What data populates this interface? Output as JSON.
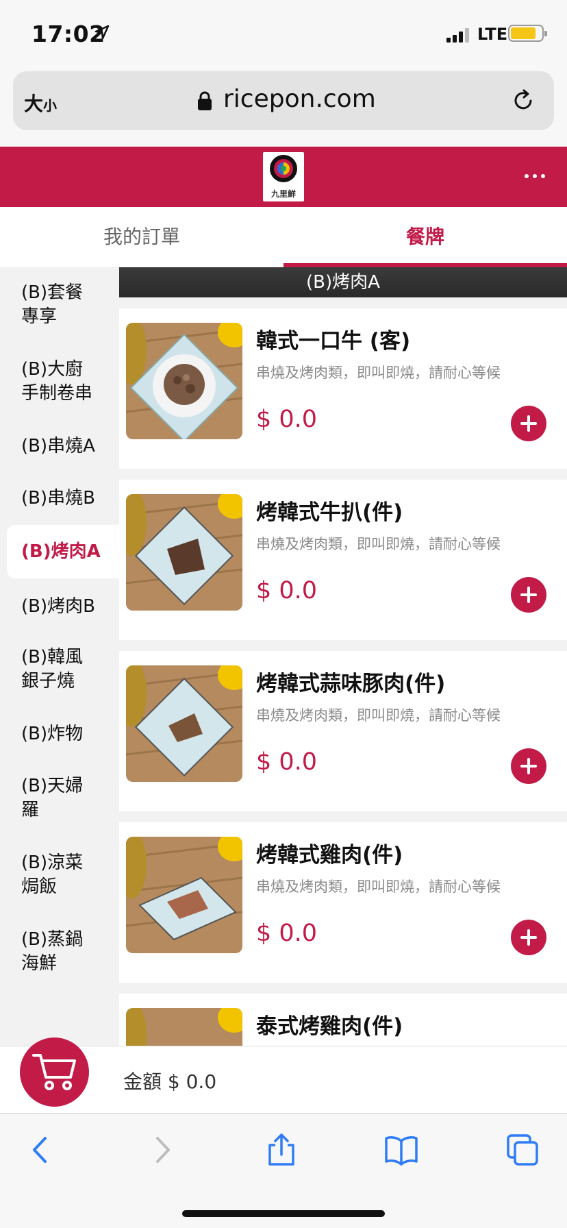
{
  "status_bar": {
    "time": "17:02",
    "network": "LTE",
    "battery_color": "#f5c518"
  },
  "browser": {
    "text_size_label": "大",
    "text_size_small": "小",
    "url": "ricepon.com"
  },
  "header": {
    "logo_text": "九里鮮",
    "brand_color": "#c21b48"
  },
  "tabs": [
    {
      "label": "我的訂單",
      "active": false
    },
    {
      "label": "餐牌",
      "active": true
    }
  ],
  "sidebar": {
    "categories": [
      {
        "label": "(B)套餐\n專享"
      },
      {
        "label": "(B)大廚\n手制卷串"
      },
      {
        "label": "(B)串燒A"
      },
      {
        "label": "(B)串燒B"
      },
      {
        "label": "(B)烤肉A",
        "active": true
      },
      {
        "label": "(B)烤肉B"
      },
      {
        "label": "(B)韓風\n銀子燒"
      },
      {
        "label": "(B)炸物"
      },
      {
        "label": "(B)天婦\n羅"
      },
      {
        "label": "(B)涼菜\n焗飯"
      },
      {
        "label": "(B)蒸鍋\n海鮮"
      }
    ]
  },
  "section": {
    "title": "(B)烤肉A"
  },
  "items": [
    {
      "name": "韓式一口牛 (客)",
      "desc": "串燒及烤肉類，即叫即燒，請耐心等候",
      "price": "$ 0.0"
    },
    {
      "name": "烤韓式牛扒(件)",
      "desc": "串燒及烤肉類，即叫即燒，請耐心等候",
      "price": "$ 0.0"
    },
    {
      "name": "烤韓式蒜味豚肉(件)",
      "desc": "串燒及烤肉類，即叫即燒，請耐心等候",
      "price": "$ 0.0"
    },
    {
      "name": "烤韓式雞肉(件)",
      "desc": "串燒及烤肉類，即叫即燒，請耐心等候",
      "price": "$ 0.0"
    },
    {
      "name": "泰式烤雞肉(件)"
    }
  ],
  "cart": {
    "amount": "金額 $ 0.0"
  },
  "icons": {
    "location": "location-arrow-icon",
    "lock": "lock-icon",
    "reload": "reload-icon",
    "more": "more-dots-icon",
    "add": "plus-icon",
    "cart": "cart-icon",
    "back": "chevron-left-icon",
    "forward": "chevron-right-icon",
    "share": "share-icon",
    "bookmarks": "book-icon",
    "tabs": "tabs-icon"
  }
}
